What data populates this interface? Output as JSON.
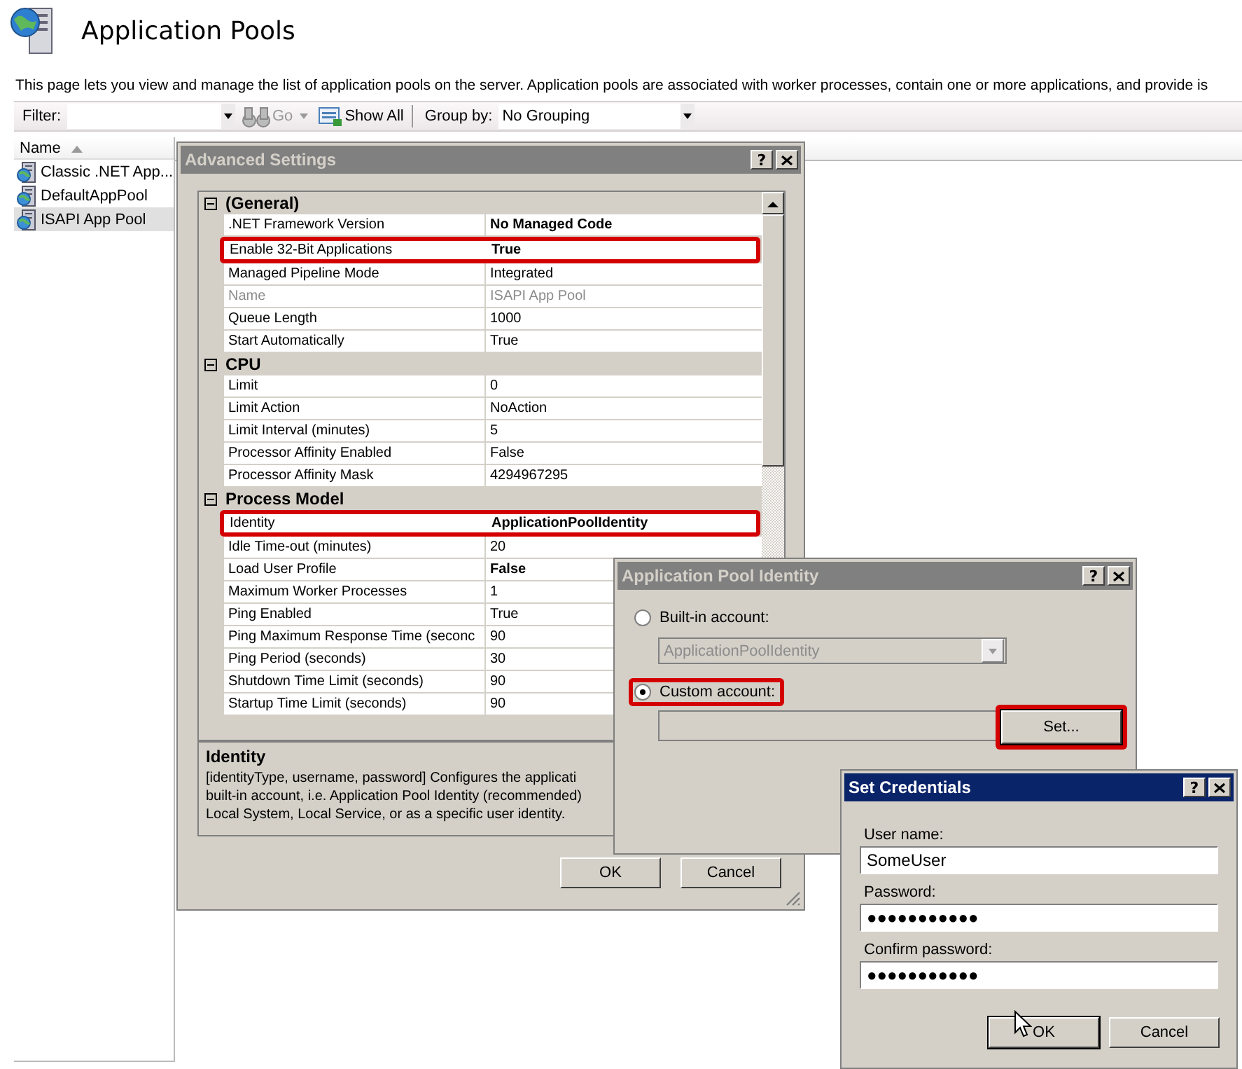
{
  "page": {
    "title": "Application Pools",
    "description": "This page lets you view and manage the list of application pools on the server. Application pools are associated with worker processes, contain one or more applications, and provide is"
  },
  "toolbar": {
    "filter_label": "Filter:",
    "go": {
      "label": "Go",
      "disabled": true
    },
    "show_all": "Show All",
    "group_by_label": "Group by:",
    "group_by_value": "No Grouping"
  },
  "pool_list": {
    "column": "Name",
    "items": [
      {
        "label": "Classic .NET App...",
        "selected": false
      },
      {
        "label": "DefaultAppPool",
        "selected": false
      },
      {
        "label": "ISAPI App Pool",
        "selected": true
      }
    ]
  },
  "advanced_settings": {
    "title": "Advanced Settings",
    "active": false,
    "help_button": "?",
    "categories": [
      {
        "name": "(General)",
        "expanded": true,
        "properties": [
          {
            "name": ".NET Framework Version",
            "value": "No Managed Code",
            "bold": true,
            "disabled": false,
            "highlighted": false
          },
          {
            "name": "Enable 32-Bit Applications",
            "value": "True",
            "bold": true,
            "disabled": false,
            "highlighted": true
          },
          {
            "name": "Managed Pipeline Mode",
            "value": "Integrated",
            "bold": false,
            "disabled": false,
            "highlighted": false
          },
          {
            "name": "Name",
            "value": "ISAPI App Pool",
            "bold": false,
            "disabled": true,
            "highlighted": false
          },
          {
            "name": "Queue Length",
            "value": "1000",
            "bold": false,
            "disabled": false,
            "highlighted": false
          },
          {
            "name": "Start Automatically",
            "value": "True",
            "bold": false,
            "disabled": false,
            "highlighted": false
          }
        ]
      },
      {
        "name": "CPU",
        "expanded": true,
        "properties": [
          {
            "name": "Limit",
            "value": "0",
            "bold": false,
            "disabled": false,
            "highlighted": false
          },
          {
            "name": "Limit Action",
            "value": "NoAction",
            "bold": false,
            "disabled": false,
            "highlighted": false
          },
          {
            "name": "Limit Interval (minutes)",
            "value": "5",
            "bold": false,
            "disabled": false,
            "highlighted": false
          },
          {
            "name": "Processor Affinity Enabled",
            "value": "False",
            "bold": false,
            "disabled": false,
            "highlighted": false
          },
          {
            "name": "Processor Affinity Mask",
            "value": "4294967295",
            "bold": false,
            "disabled": false,
            "highlighted": false
          }
        ]
      },
      {
        "name": "Process Model",
        "expanded": true,
        "properties": [
          {
            "name": "Identity",
            "value": "ApplicationPoolIdentity",
            "bold": true,
            "disabled": false,
            "highlighted": true
          },
          {
            "name": "Idle Time-out (minutes)",
            "value": "20",
            "bold": false,
            "disabled": false,
            "highlighted": false
          },
          {
            "name": "Load User Profile",
            "value": "False",
            "bold": true,
            "disabled": false,
            "highlighted": false
          },
          {
            "name": "Maximum Worker Processes",
            "value": "1",
            "bold": false,
            "disabled": false,
            "highlighted": false
          },
          {
            "name": "Ping Enabled",
            "value": "True",
            "bold": false,
            "disabled": false,
            "highlighted": false
          },
          {
            "name": "Ping Maximum Response Time (seconc",
            "value": "90",
            "bold": false,
            "disabled": false,
            "highlighted": false
          },
          {
            "name": "Ping Period (seconds)",
            "value": "30",
            "bold": false,
            "disabled": false,
            "highlighted": false
          },
          {
            "name": "Shutdown Time Limit (seconds)",
            "value": "90",
            "bold": false,
            "disabled": false,
            "highlighted": false
          },
          {
            "name": "Startup Time Limit (seconds)",
            "value": "90",
            "bold": false,
            "disabled": false,
            "highlighted": false
          }
        ]
      }
    ],
    "description": {
      "title": "Identity",
      "lines": [
        "[identityType, username, password] Configures the applicati",
        "built-in account, i.e. Application Pool Identity (recommended)",
        "Local System, Local Service, or as a specific user identity."
      ]
    },
    "buttons": [
      "OK",
      "Cancel"
    ]
  },
  "identity_dialog": {
    "title": "Application Pool Identity",
    "active": false,
    "help_button": "?",
    "options": [
      {
        "label": "Built-in account:",
        "selected": false,
        "highlighted": false
      },
      {
        "label": "Custom account:",
        "selected": true,
        "highlighted": true
      }
    ],
    "builtin_value": "ApplicationPoolIdentity",
    "builtin_disabled": true,
    "set_button": {
      "label": "Set...",
      "highlighted": true
    }
  },
  "credentials_dialog": {
    "title": "Set Credentials",
    "active": true,
    "help_button": "?",
    "fields": [
      {
        "label": "User name:",
        "value": "SomeUser"
      },
      {
        "label": "Password:",
        "value": "●●●●●●●●●●●"
      },
      {
        "label": "Confirm password:",
        "value": "●●●●●●●●●●●"
      }
    ],
    "buttons": [
      {
        "label": "OK",
        "default": true
      },
      {
        "label": "Cancel",
        "default": false
      }
    ]
  }
}
